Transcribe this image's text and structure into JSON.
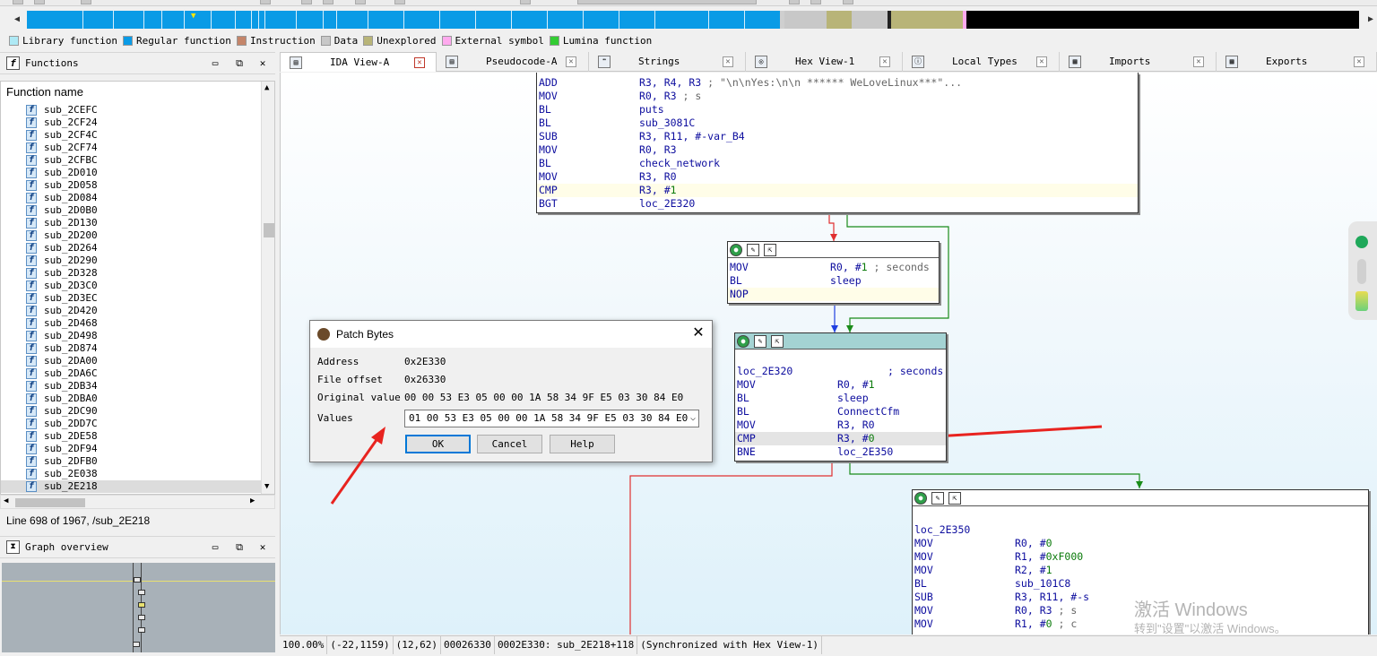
{
  "legend": [
    {
      "label": "Library function",
      "color": "#aee9f5"
    },
    {
      "label": "Regular function",
      "color": "#0a9be6"
    },
    {
      "label": "Instruction",
      "color": "#c4856a"
    },
    {
      "label": "Data",
      "color": "#c8c8c8"
    },
    {
      "label": "Unexplored",
      "color": "#b8b478"
    },
    {
      "label": "External symbol",
      "color": "#ffaaee"
    },
    {
      "label": "Lumina function",
      "color": "#33cc33"
    }
  ],
  "functions_panel": {
    "title": "Functions",
    "column_header": "Function name",
    "items": [
      "sub_2CEFC",
      "sub_2CF24",
      "sub_2CF4C",
      "sub_2CF74",
      "sub_2CFBC",
      "sub_2D010",
      "sub_2D058",
      "sub_2D084",
      "sub_2D0B0",
      "sub_2D130",
      "sub_2D200",
      "sub_2D264",
      "sub_2D290",
      "sub_2D328",
      "sub_2D3C0",
      "sub_2D3EC",
      "sub_2D420",
      "sub_2D468",
      "sub_2D498",
      "sub_2D874",
      "sub_2DA00",
      "sub_2DA6C",
      "sub_2DB34",
      "sub_2DBA0",
      "sub_2DC90",
      "sub_2DD7C",
      "sub_2DE58",
      "sub_2DF94",
      "sub_2DFB0",
      "sub_2E038",
      "sub_2E218"
    ],
    "selected": "sub_2E218",
    "status": "Line 698 of 1967, /sub_2E218"
  },
  "graph_overview": {
    "title": "Graph overview"
  },
  "tabs": [
    {
      "label": "IDA View-A",
      "active": true
    },
    {
      "label": "Pseudocode-A",
      "active": false
    },
    {
      "label": "Strings",
      "active": false
    },
    {
      "label": "Hex View-1",
      "active": false
    },
    {
      "label": "Local Types",
      "active": false
    },
    {
      "label": "Imports",
      "active": false
    },
    {
      "label": "Exports",
      "active": false
    }
  ],
  "blocks": {
    "b1": [
      {
        "mn": "ADD",
        "op": "R3, R4, R3 ; \"\\n\\nYes:\\n\\n      ****** WeLoveLinux***\"..."
      },
      {
        "mn": "MOV",
        "op": "R0, R3  ; s"
      },
      {
        "mn": "BL",
        "op": "puts"
      },
      {
        "mn": "BL",
        "op": "sub_3081C"
      },
      {
        "mn": "SUB",
        "op": "R3, R11, #-var_B4"
      },
      {
        "mn": "MOV",
        "op": "R0, R3"
      },
      {
        "mn": "BL",
        "op": "check_network"
      },
      {
        "mn": "MOV",
        "op": "R3, R0"
      },
      {
        "mn": "CMP",
        "op": "R3, #1"
      },
      {
        "mn": "BGT",
        "op": "loc_2E320"
      }
    ],
    "b2": [
      {
        "mn": "MOV",
        "op": "R0, #1  ; seconds"
      },
      {
        "mn": "BL",
        "op": "sleep"
      },
      {
        "mn": "NOP",
        "op": ""
      }
    ],
    "b3_label": "loc_2E320",
    "b3_label_comment": "; seconds",
    "b3": [
      {
        "mn": "MOV",
        "op": "R0, #1"
      },
      {
        "mn": "BL",
        "op": "sleep"
      },
      {
        "mn": "BL",
        "op": "ConnectCfm"
      },
      {
        "mn": "MOV",
        "op": "R3, R0"
      },
      {
        "mn": "CMP",
        "op": "R3, #0"
      },
      {
        "mn": "BNE",
        "op": "loc_2E350"
      }
    ],
    "b4_label": "loc_2E350",
    "b4": [
      {
        "mn": "MOV",
        "op": "R0, #0"
      },
      {
        "mn": "MOV",
        "op": "R1, #0xF000"
      },
      {
        "mn": "MOV",
        "op": "R2, #1"
      },
      {
        "mn": "BL",
        "op": "sub_101C8"
      },
      {
        "mn": "SUB",
        "op": "R3, R11, #-s"
      },
      {
        "mn": "MOV",
        "op": "R0, R3  ; s"
      },
      {
        "mn": "MOV",
        "op": "R1, #0  ; c"
      }
    ]
  },
  "dialog": {
    "title": "Patch Bytes",
    "address_label": "Address",
    "address": "0x2E330",
    "offset_label": "File offset",
    "offset": "0x26330",
    "original_label": "Original value",
    "original": "00 00 53 E3 05 00 00 1A 58 34 9F E5 03 30 84 E0",
    "values_label": "Values",
    "values": "01 00 53 E3 05 00 00 1A 58 34 9F E5 03 30 84 E0",
    "ok": "OK",
    "cancel": "Cancel",
    "help": "Help"
  },
  "status_bar": [
    "100.00%",
    "(-22,1159)",
    "(12,62)",
    "00026330",
    "0002E330: sub_2E218+118",
    "(Synchronized with Hex View-1)"
  ],
  "watermark": {
    "line1": "激活 Windows",
    "line2": "转到\"设置\"以激活 Windows。"
  },
  "colors": {
    "annotation_arrow": "#e8231f",
    "edge_true": "#1a8c1a",
    "edge_false": "#e03030",
    "edge_normal": "#1f3fe0"
  }
}
